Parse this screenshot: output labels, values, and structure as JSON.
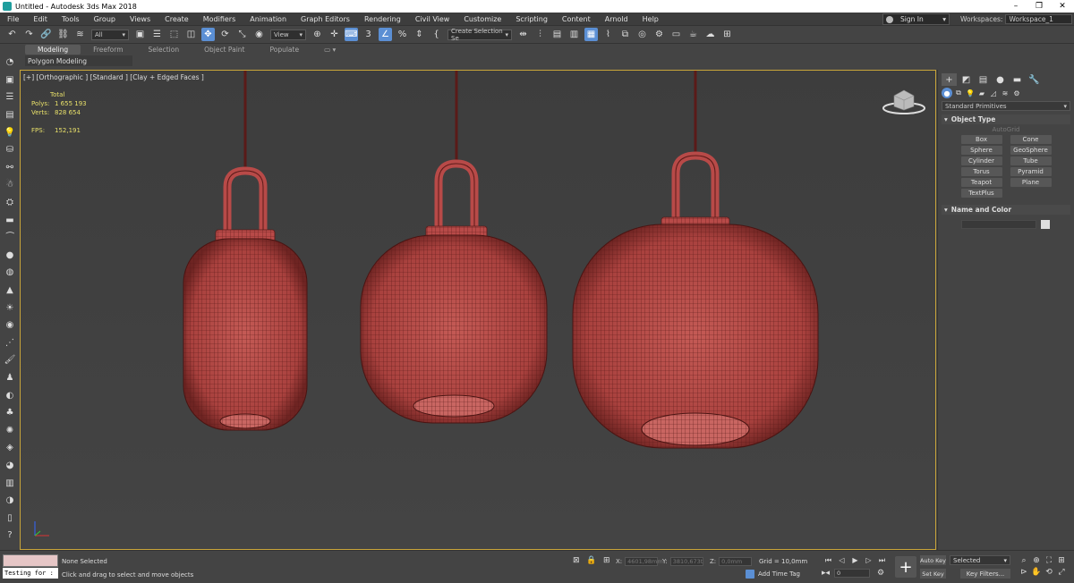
{
  "window": {
    "title": "Untitled - Autodesk 3ds Max 2018",
    "controls": [
      "–",
      "❐",
      "✕"
    ]
  },
  "menu": [
    "File",
    "Edit",
    "Tools",
    "Group",
    "Views",
    "Create",
    "Modifiers",
    "Animation",
    "Graph Editors",
    "Rendering",
    "Civil View",
    "Customize",
    "Scripting",
    "Content",
    "Arnold",
    "Help"
  ],
  "account": {
    "sign_in": "Sign In",
    "workspaces_label": "Workspaces:",
    "workspace": "Workspace_1"
  },
  "toolbar": {
    "filter": "All",
    "coord_system": "View",
    "selection_set": "Create Selection Se",
    "snap_value": "3"
  },
  "ribbon": {
    "tabs": [
      "Modeling",
      "Freeform",
      "Selection",
      "Object Paint",
      "Populate"
    ],
    "subtitle": "Polygon Modeling"
  },
  "viewport": {
    "label": "[+] [Orthographic ] [Standard ] [Clay + Edged Faces ]",
    "stats": {
      "header": "Total",
      "polys_label": "Polys:",
      "polys": "1 655 193",
      "verts_label": "Verts:",
      "verts": "828 654",
      "fps_label": "FPS:",
      "fps": "152,191"
    },
    "lantern_color": "#b84a48",
    "border_color": "#c9a53a"
  },
  "command_panel": {
    "category": "Standard Primitives",
    "object_type": "Object Type",
    "autogrid": "AutoGrid",
    "buttons": [
      "Box",
      "Cone",
      "Sphere",
      "GeoSphere",
      "Cylinder",
      "Tube",
      "Torus",
      "Pyramid",
      "Teapot",
      "Plane",
      "TextPlus"
    ],
    "name_and_color": "Name and Color"
  },
  "status": {
    "script_listener": "Testing for :",
    "selection": "None Selected",
    "prompt": "Click and drag to select and move objects",
    "x_label": "X:",
    "x": "4601,98mm",
    "y_label": "Y:",
    "y": "3810,673t",
    "z_label": "Z:",
    "z": "0,0mm",
    "grid": "Grid = 10,0mm",
    "add_time_tag": "Add Time Tag",
    "frame": "0",
    "auto_key": "Auto Key",
    "set_key": "Set Key",
    "key_mode": "Selected",
    "key_filters": "Key Filters..."
  }
}
